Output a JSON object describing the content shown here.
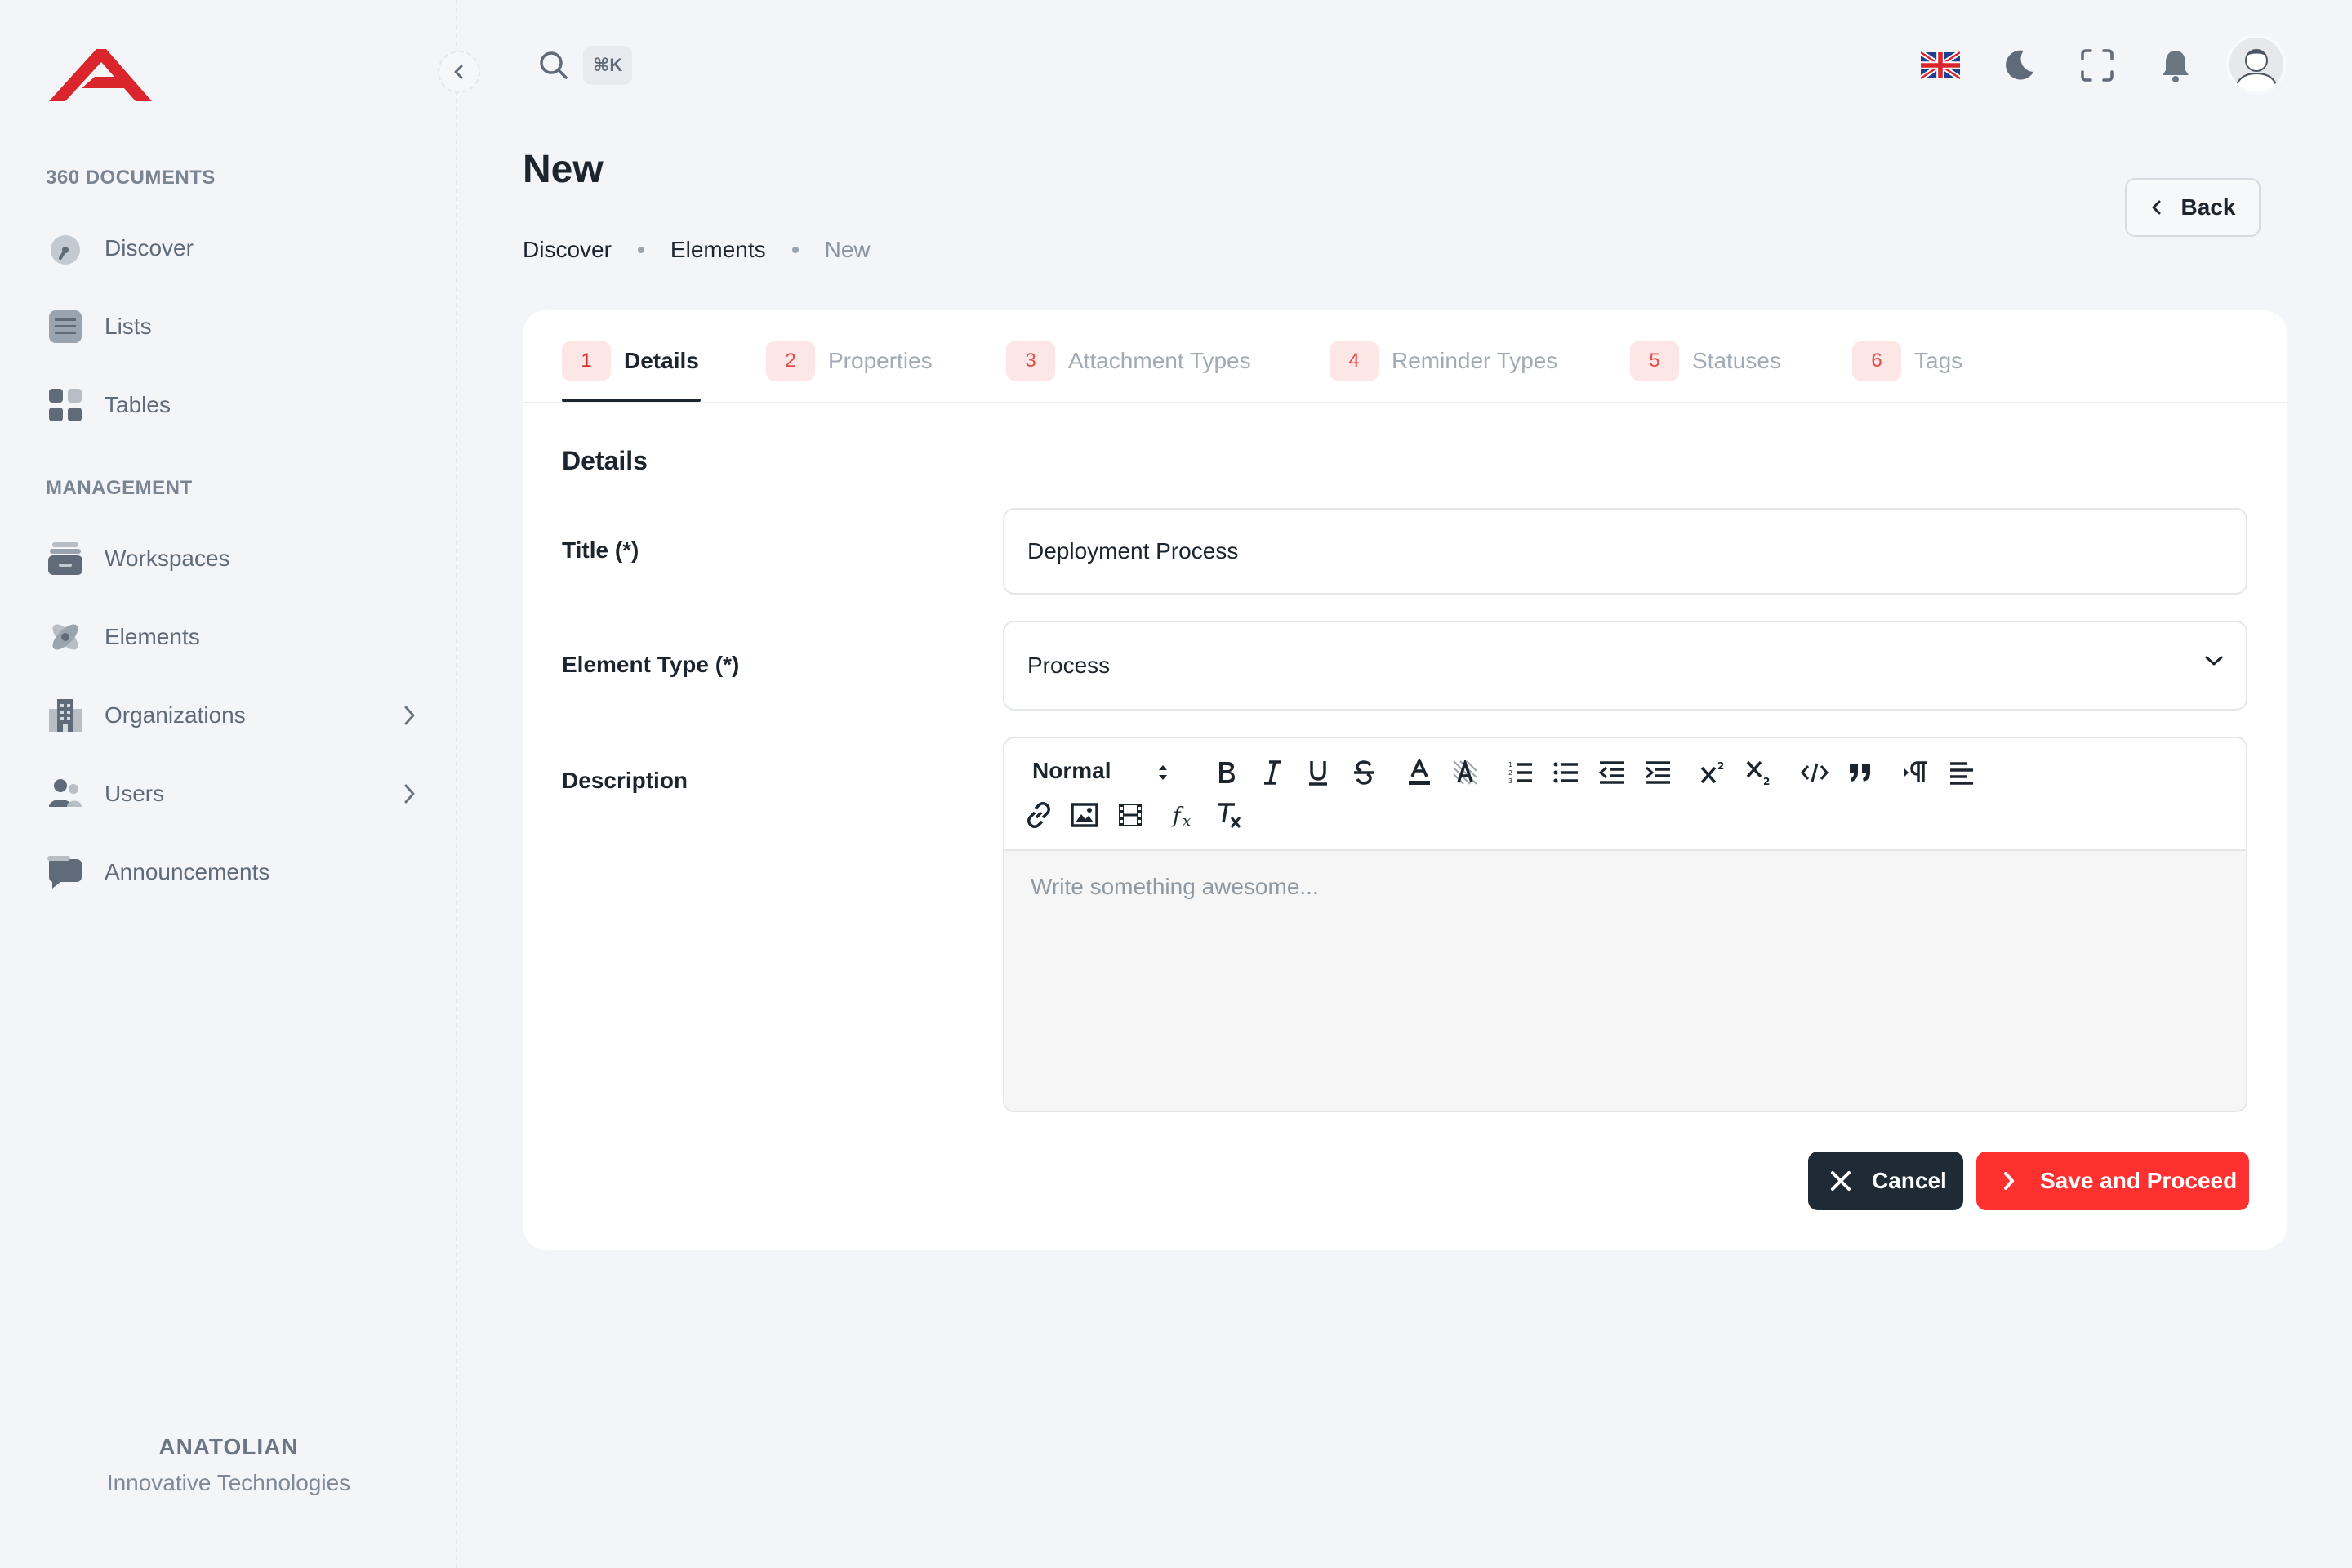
{
  "sidebar": {
    "section1": "360 DOCUMENTS",
    "section2": "MANAGEMENT",
    "items": [
      {
        "label": "Discover",
        "icon": "speedometer-icon"
      },
      {
        "label": "Lists",
        "icon": "list-icon"
      },
      {
        "label": "Tables",
        "icon": "grid-icon"
      },
      {
        "label": "Workspaces",
        "icon": "inbox-icon"
      },
      {
        "label": "Elements",
        "icon": "atom-icon"
      },
      {
        "label": "Organizations",
        "icon": "building-icon"
      },
      {
        "label": "Users",
        "icon": "users-icon"
      },
      {
        "label": "Announcements",
        "icon": "chat-icon"
      }
    ],
    "brand_name": "ANATOLIAN",
    "brand_sub": "Innovative Technologies"
  },
  "header": {
    "shortcut": "⌘K"
  },
  "page": {
    "title": "New",
    "breadcrumb": [
      "Discover",
      "Elements",
      "New"
    ],
    "back_label": "Back"
  },
  "tabs": [
    {
      "num": "1",
      "label": "Details"
    },
    {
      "num": "2",
      "label": "Properties"
    },
    {
      "num": "3",
      "label": "Attachment Types"
    },
    {
      "num": "4",
      "label": "Reminder Types"
    },
    {
      "num": "5",
      "label": "Statuses"
    },
    {
      "num": "6",
      "label": "Tags"
    }
  ],
  "form": {
    "section_title": "Details",
    "title_label": "Title (*)",
    "title_value": "Deployment Process",
    "type_label": "Element Type (*)",
    "type_value": "Process",
    "desc_label": "Description",
    "editor_format": "Normal",
    "editor_placeholder": "Write something awesome...",
    "cancel_label": "Cancel",
    "save_label": "Save and Proceed"
  },
  "colors": {
    "accent": "#ff3030",
    "dark_button": "#1e2a36",
    "background": "#f3f5f8"
  }
}
